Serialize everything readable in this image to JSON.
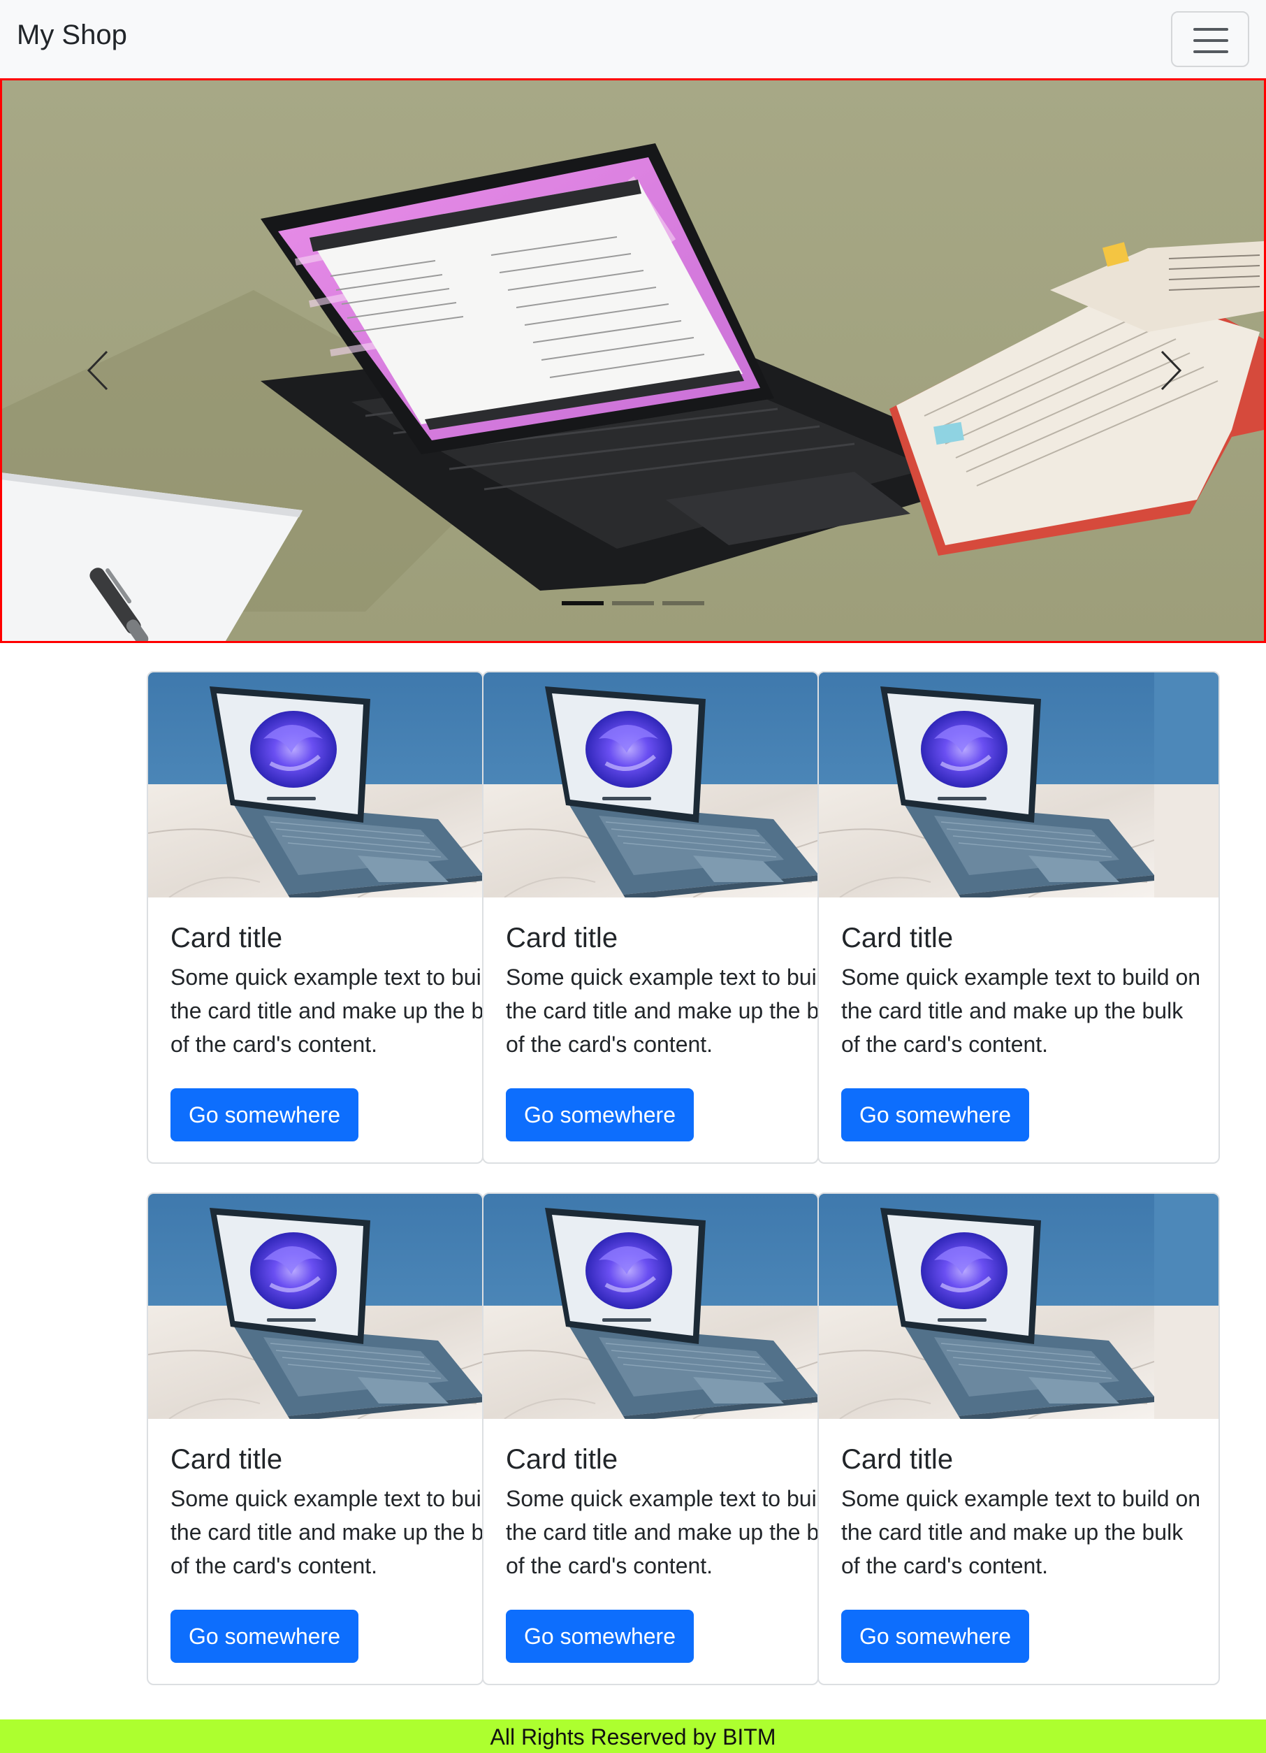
{
  "navbar": {
    "brand": "My Shop",
    "toggle_icon": "hamburger-menu-icon"
  },
  "carousel": {
    "slides": [
      {
        "image": "laptop-on-desk-with-book-photo",
        "active": true
      },
      {
        "image": "carousel-slide-2",
        "active": false
      },
      {
        "image": "carousel-slide-3",
        "active": false
      }
    ],
    "prev_icon": "chevron-left-icon",
    "next_icon": "chevron-right-icon"
  },
  "cards": [
    {
      "image": "laptop-on-marble-photo",
      "title": "Card title",
      "text": "Some quick example text to build on the card title and make up the bulk of the card's content.",
      "button": "Go somewhere"
    },
    {
      "image": "laptop-on-marble-photo",
      "title": "Card title",
      "text": "Some quick example text to build on the card title and make up the bulk of the card's content.",
      "button": "Go somewhere"
    },
    {
      "image": "laptop-on-marble-photo",
      "title": "Card title",
      "text": "Some quick example text to build on the card title and make up the bulk of the card's content.",
      "button": "Go somewhere"
    },
    {
      "image": "laptop-on-marble-photo",
      "title": "Card title",
      "text": "Some quick example text to build on the card title and make up the bulk of the card's content.",
      "button": "Go somewhere"
    },
    {
      "image": "laptop-on-marble-photo",
      "title": "Card title",
      "text": "Some quick example text to build on the card title and make up the bulk of the card's content.",
      "button": "Go somewhere"
    },
    {
      "image": "laptop-on-marble-photo",
      "title": "Card title",
      "text": "Some quick example text to build on the card title and make up the bulk of the card's content.",
      "button": "Go somewhere"
    }
  ],
  "colors": {
    "primary_button": "#0d6efd",
    "footer_bg": "#adff2f",
    "carousel_border": "#ff0000",
    "navbar_bg": "#f8f9fa"
  },
  "footer": {
    "text": "All Rights Reserved by BITM"
  }
}
